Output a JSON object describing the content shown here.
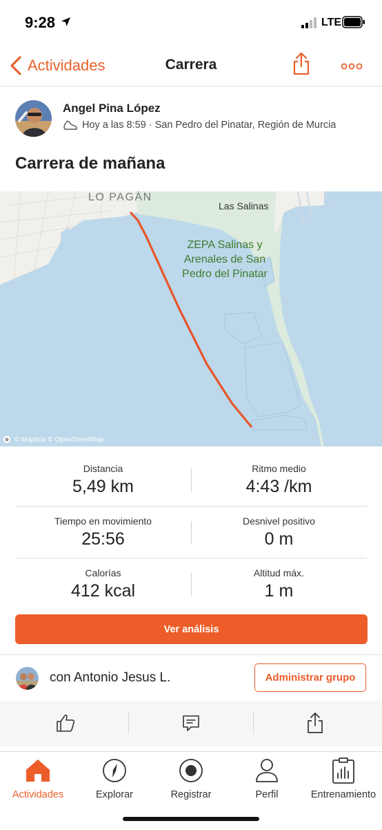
{
  "status_bar": {
    "time": "9:28",
    "network": "LTE"
  },
  "nav": {
    "back_label": "Actividades",
    "title": "Carrera"
  },
  "athlete": {
    "name": "Angel Pina López",
    "meta": "Hoy a las 8:59 · San Pedro del Pinatar, Región de Murcia"
  },
  "activity": {
    "title": "Carrera de mañana"
  },
  "map": {
    "town_label": "LO PAGÁN",
    "place_label": "Las Salinas",
    "park_label": "ZEPA Salinas y Arenales de San Pedro del Pinatar",
    "attribution": "© Mapbox © OpenStreetMap",
    "route_color": "#e8562a"
  },
  "stats": [
    {
      "label": "Distancia",
      "value": "5,49 km"
    },
    {
      "label": "Ritmo medio",
      "value": "4:43 /km"
    },
    {
      "label": "Tiempo en movimiento",
      "value": "25:56"
    },
    {
      "label": "Desnivel positivo",
      "value": "0 m"
    },
    {
      "label": "Calorías",
      "value": "412 kcal"
    },
    {
      "label": "Altitud máx.",
      "value": "1 m"
    }
  ],
  "analysis_button": "Ver análisis",
  "group": {
    "text": "con Antonio Jesus L.",
    "button": "Administrar grupo"
  },
  "actions": [
    "thumbs-up-icon",
    "comment-icon",
    "share-icon"
  ],
  "tabs": [
    {
      "label": "Actividades",
      "icon": "home-icon",
      "active": true
    },
    {
      "label": "Explorar",
      "icon": "compass-icon",
      "active": false
    },
    {
      "label": "Registrar",
      "icon": "record-icon",
      "active": false
    },
    {
      "label": "Perfil",
      "icon": "person-icon",
      "active": false
    },
    {
      "label": "Entrenamiento",
      "icon": "training-icon",
      "active": false
    }
  ],
  "colors": {
    "accent": "#ec5d29",
    "water": "#bcd8ea",
    "park": "#dcebdd"
  }
}
